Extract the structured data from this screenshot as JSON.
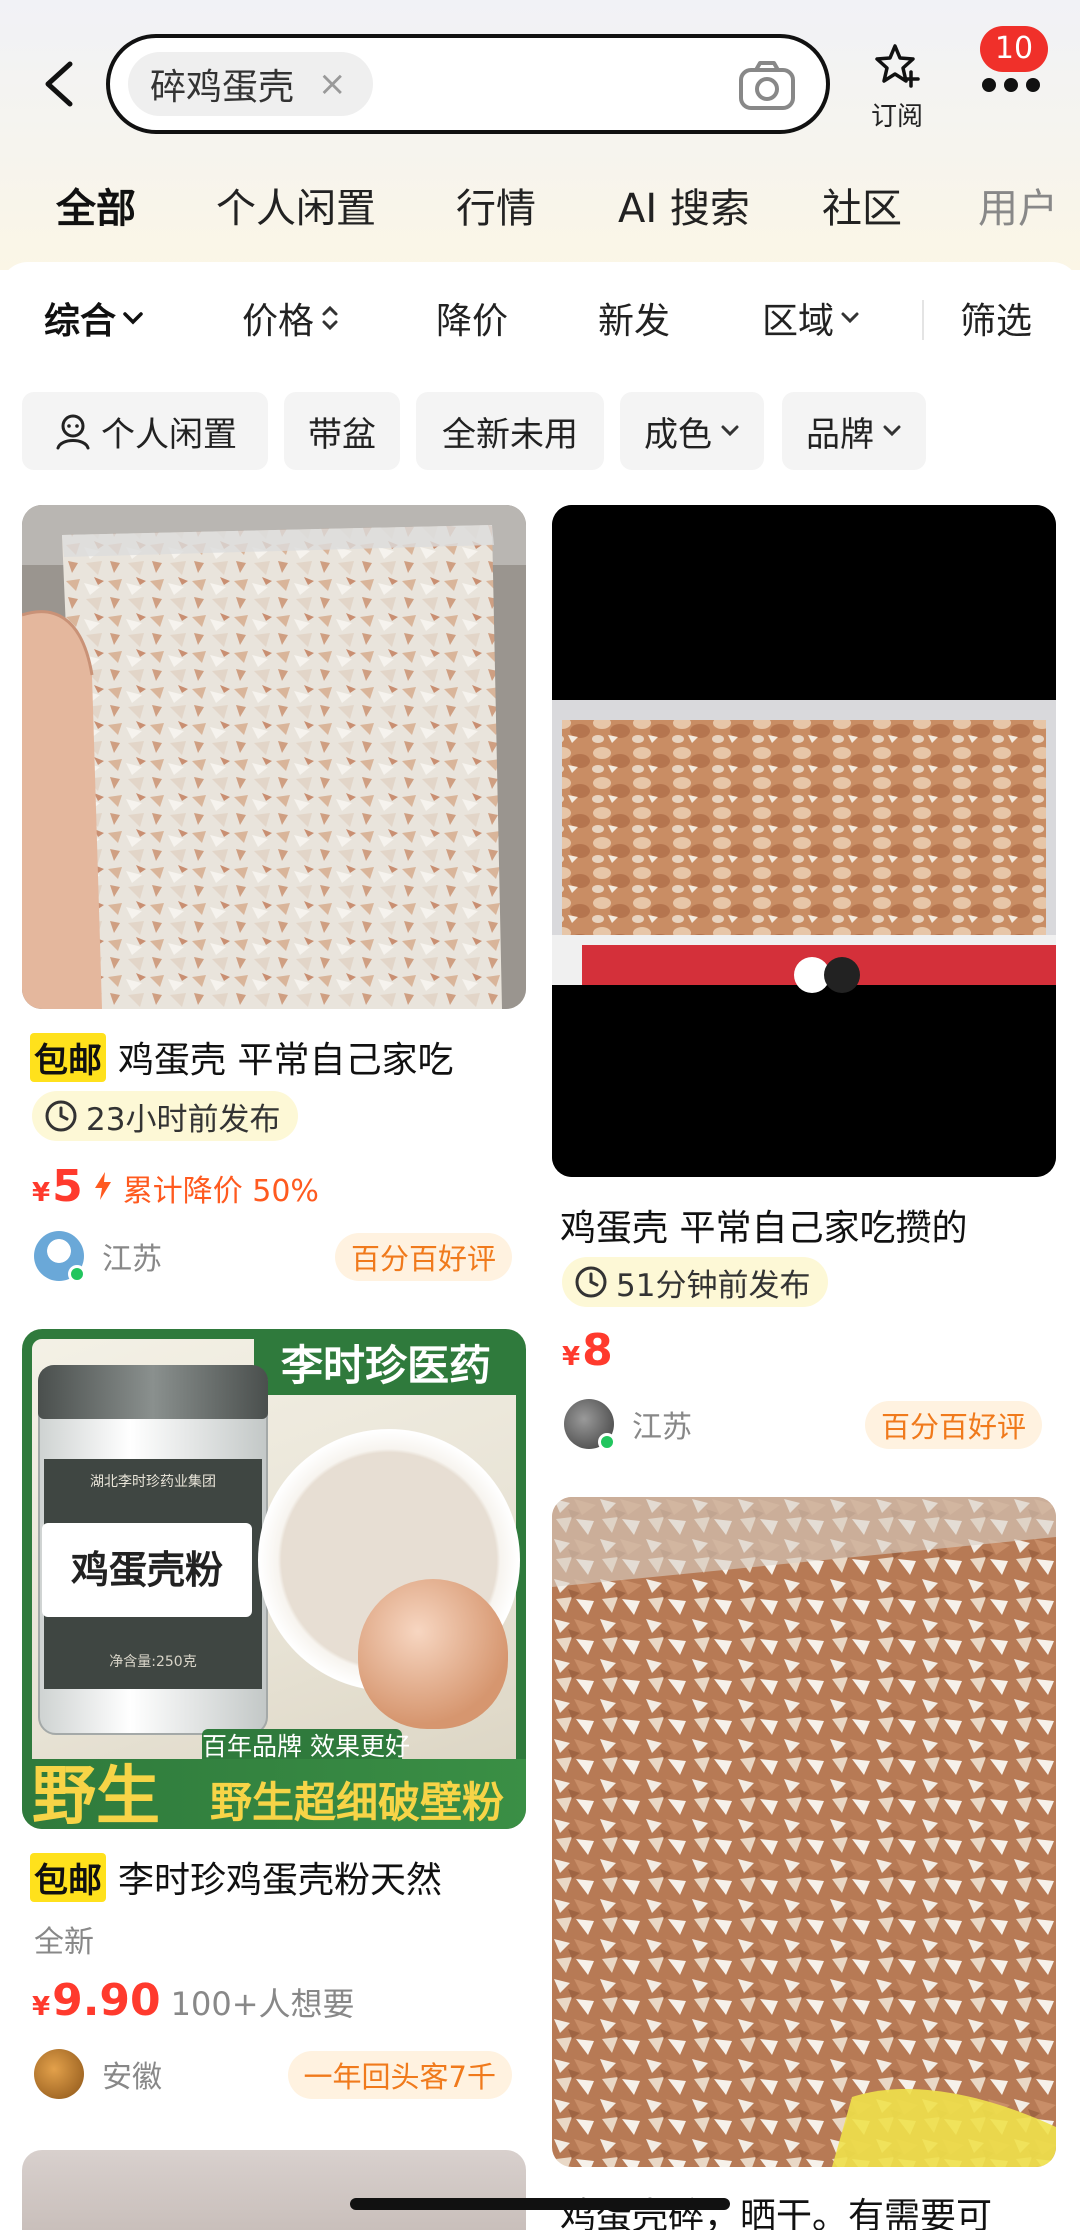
{
  "search": {
    "query": "碎鸡蛋壳",
    "clear_glyph": "×"
  },
  "header": {
    "subscribe_label": "订阅",
    "notification_count": "10"
  },
  "tabs": [
    "全部",
    "个人闲置",
    "行情",
    "AI 搜索",
    "社区",
    "用户"
  ],
  "sort": [
    "综合",
    "价格",
    "降价",
    "新发",
    "区域",
    "筛选"
  ],
  "chips": [
    "个人闲置",
    "带盆",
    "全新未用",
    "成色",
    "品牌"
  ],
  "cards": [
    {
      "tag": "包邮",
      "title": "鸡蛋壳 平常自己家吃",
      "time": "23小时前发布",
      "price": "5",
      "price_note": "累计降价 50%",
      "region": "江苏",
      "badge": "百分百好评"
    },
    {
      "title": "鸡蛋壳 平常自己家吃攒的",
      "time": "51分钟前发布",
      "price": "8",
      "region": "江苏",
      "badge": "百分百好评"
    },
    {
      "tag": "包邮",
      "title": "李时珍鸡蛋壳粉天然",
      "condition": "全新",
      "price": "9.90",
      "want": "100+人想要",
      "region": "安徽",
      "badge": "一年回头客7千",
      "image_text": {
        "top": "李时珍医药",
        "jar_brand": "湖北李时珍药业集团",
        "jar_label": "鸡蛋壳粉",
        "jar_weight": "净含量:250克",
        "slogan": "百年品牌 效果更好",
        "wild": "野生",
        "bottom": "野生超细破壁粉"
      }
    },
    {
      "title": "鸡蛋壳碎，晒干。有需要可"
    }
  ],
  "currency": "¥",
  "icons": {
    "back": "back-arrow-icon",
    "camera": "camera-icon",
    "subscribe": "star-plus-icon",
    "more": "more-dots-icon",
    "clock": "clock-icon",
    "lightning": "lightning-icon",
    "person": "person-icon"
  },
  "colors": {
    "accent_yellow": "#ffe11c",
    "price_red": "#ff3a2d",
    "badge_orange": "#f07a1c"
  }
}
